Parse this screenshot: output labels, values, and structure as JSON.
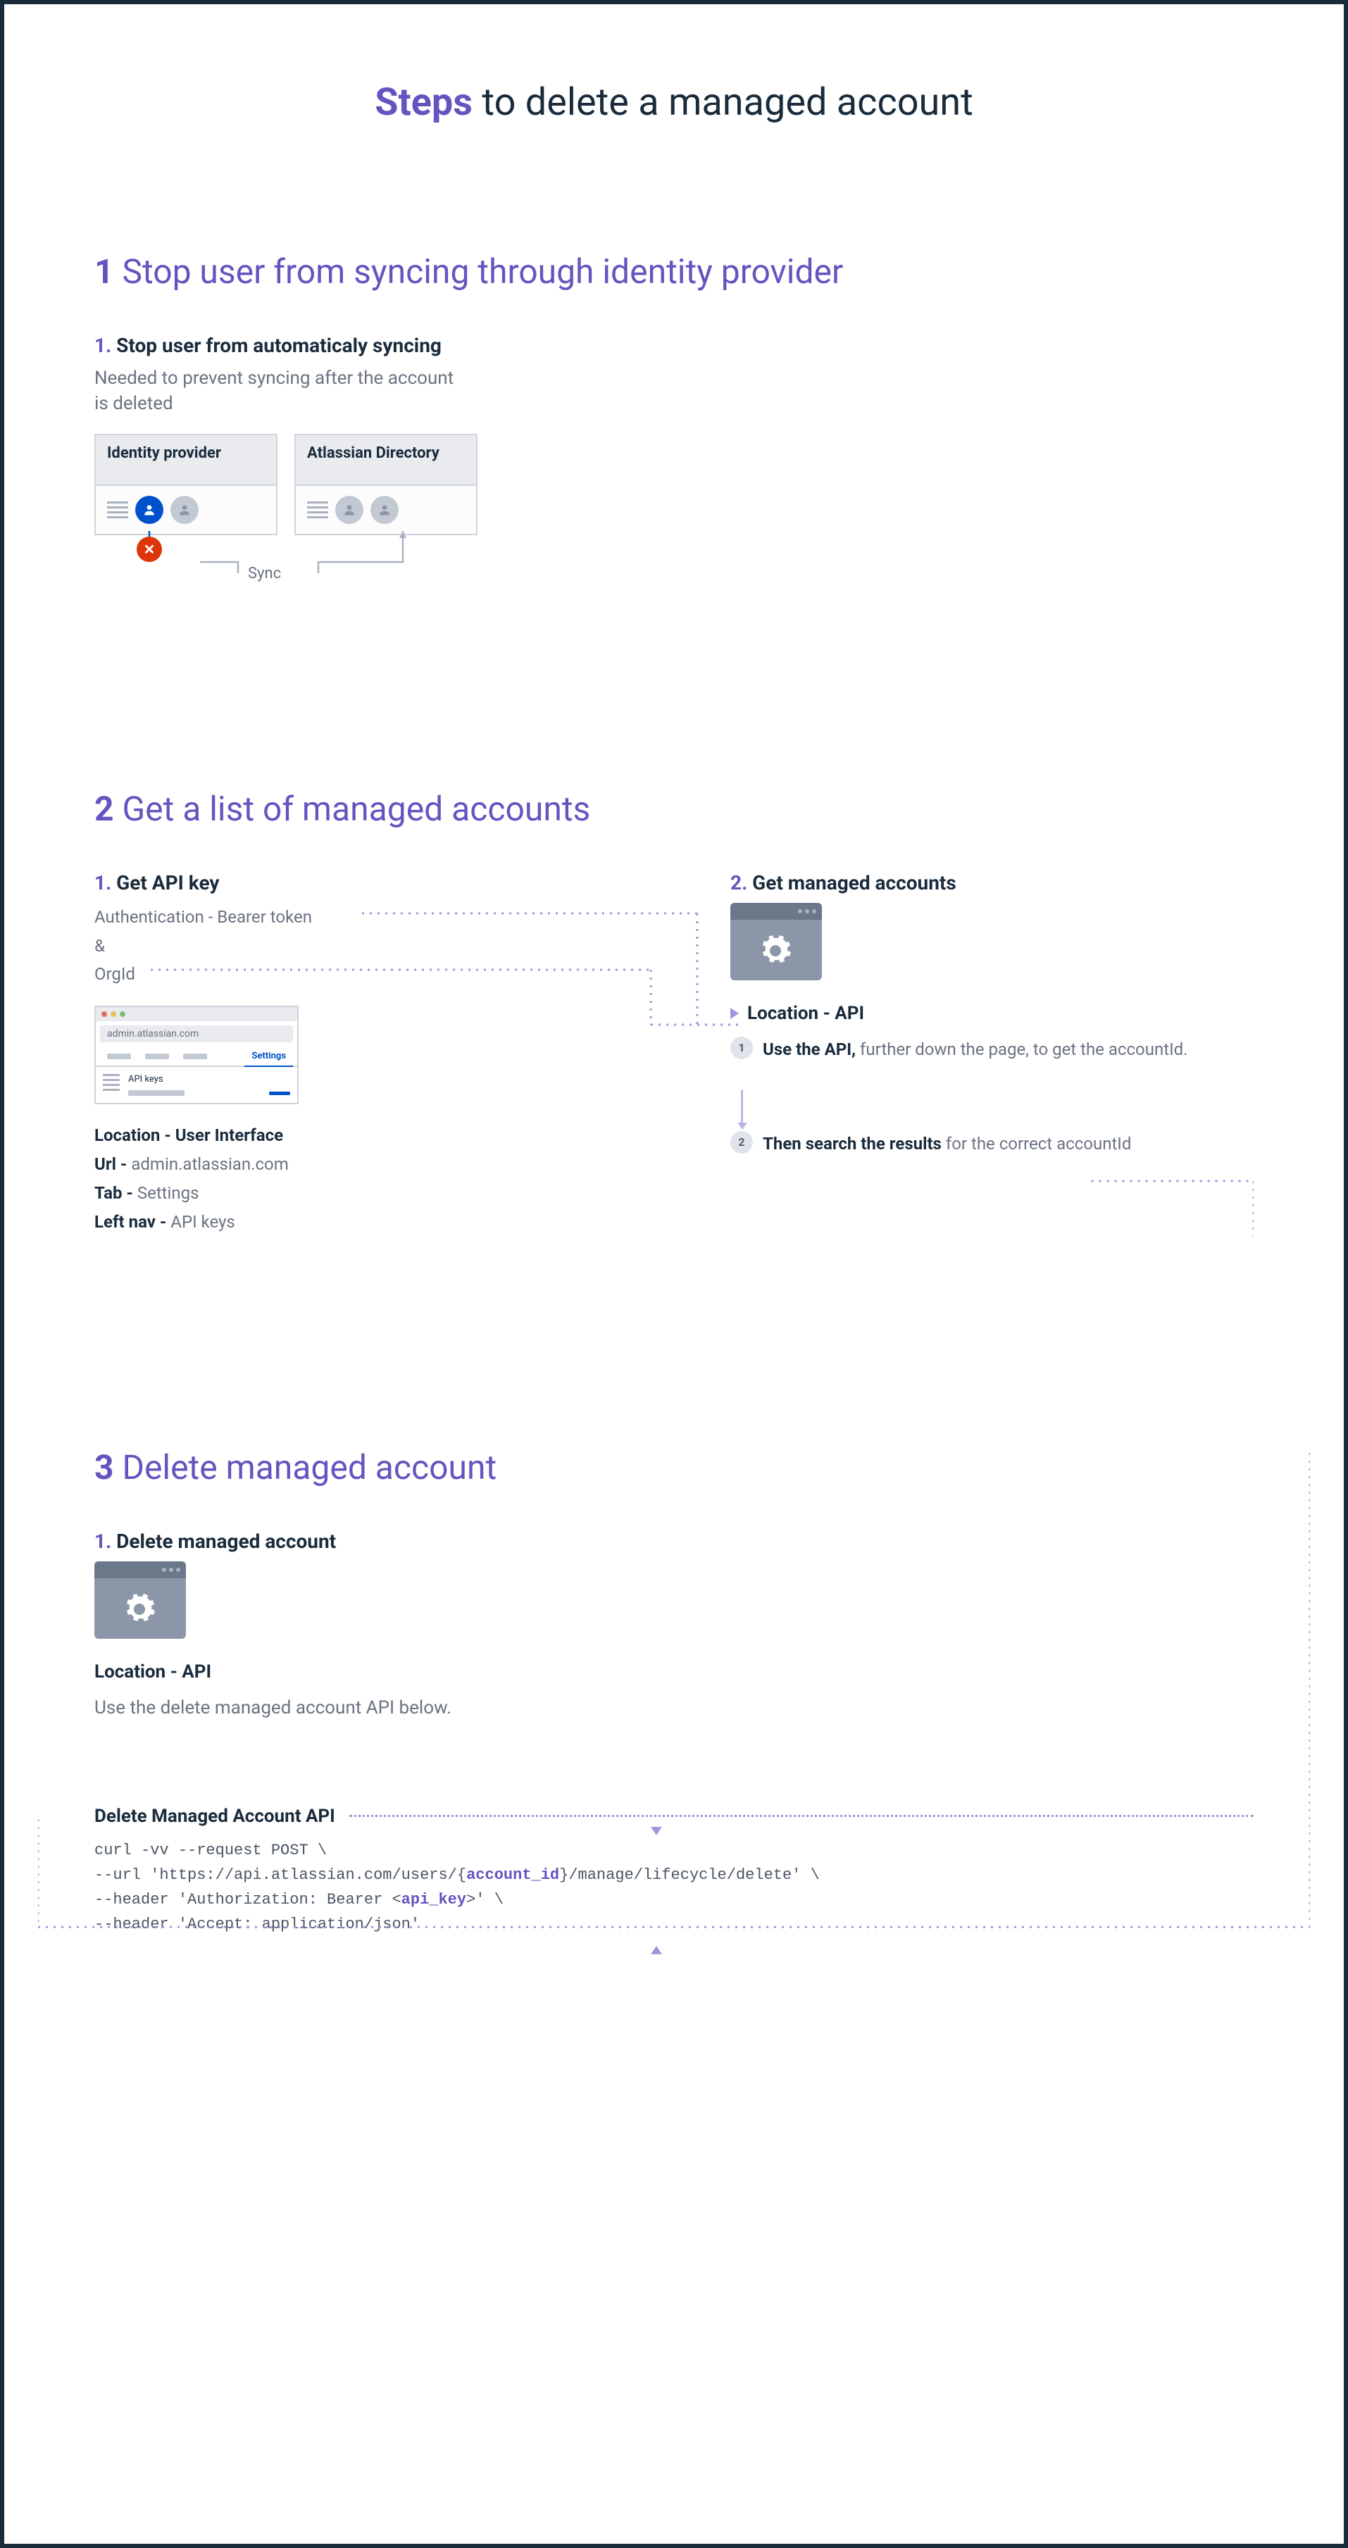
{
  "title": {
    "highlight": "Steps",
    "rest": " to delete a managed account"
  },
  "section1": {
    "num": "1",
    "title": "Stop user from syncing through identity provider",
    "sub1": {
      "num": "1.",
      "title": "Stop user from automaticaly syncing",
      "desc": "Needed to prevent syncing after the account is deleted"
    },
    "idpBox": "Identity provider",
    "atlBox": "Atlassian Directory",
    "syncLabel": "Sync"
  },
  "section2": {
    "num": "2",
    "title": "Get a list of managed accounts",
    "left": {
      "num": "1.",
      "title": "Get API key",
      "auth": "Authentication - Bearer token",
      "amp": "&",
      "orgid": "OrgId",
      "browser": {
        "url": "admin.atlassian.com",
        "tabActive": "Settings",
        "navItem": "API keys"
      },
      "locTitle": "Location - User Interface",
      "urlLbl": "Url -",
      "urlVal": "admin.atlassian.com",
      "tabLbl": "Tab -",
      "tabVal": "Settings",
      "navLbl": "Left nav -",
      "navVal": "API keys"
    },
    "right": {
      "num": "2.",
      "title": "Get managed accounts",
      "locTitle": "Location - API",
      "step1b": "Use the API,",
      "step1r": " further down the page, to get the accountId.",
      "step2b": "Then search the results",
      "step2r": " for the correct accountId"
    }
  },
  "section3": {
    "num": "3",
    "title": "Delete managed account",
    "sub1": {
      "num": "1.",
      "title": "Delete managed account",
      "locTitle": "Location - API",
      "desc": "Use the delete managed account API below."
    },
    "api": {
      "title": "Delete Managed Account API",
      "line1": "curl -vv --request POST \\",
      "line2a": "--url 'https://api.atlassian.com/users/{",
      "line2b": "account_id",
      "line2c": "}/manage/lifecycle/delete' \\",
      "line3a": "--header 'Authorization: Bearer <",
      "line3b": "api_key",
      "line3c": ">' \\",
      "line4": "--header 'Accept: application/json'"
    }
  }
}
